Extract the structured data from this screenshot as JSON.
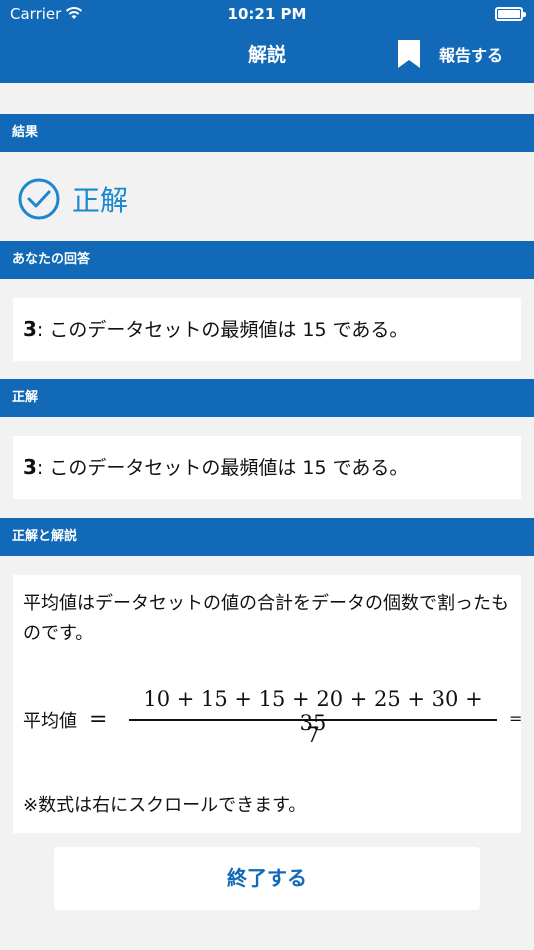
{
  "status_bar": {
    "carrier": "Carrier",
    "time": "10:21 PM"
  },
  "nav": {
    "title": "解説",
    "report_label": "報告する",
    "report_icon": "bookmark-icon"
  },
  "colors": {
    "primary": "#1169b7",
    "accent": "#1a87cf",
    "background": "#f2f2f2"
  },
  "sections": {
    "result": {
      "header": "結果",
      "value": "正解",
      "icon": "check-circle-icon"
    },
    "your_answer": {
      "header": "あなたの回答",
      "number": "3",
      "text": ": このデータセットの最頻値は 15 である。"
    },
    "correct_answer": {
      "header": "正解",
      "number": "3",
      "text": ": このデータセットの最頻値は 15 である。"
    },
    "explanation": {
      "header": "正解と解説",
      "text": "平均値はデータセットの値の合計をデータの個数で割ったものです。",
      "formula": {
        "label": "平均値",
        "equals": "=",
        "numerator": "10 + 15 + 15 + 20 + 25 + 30 + 35",
        "denominator": "7",
        "trailing": "="
      },
      "note": "※数式は右にスクロールできます。"
    }
  },
  "finish_button": {
    "label": "終了する"
  }
}
